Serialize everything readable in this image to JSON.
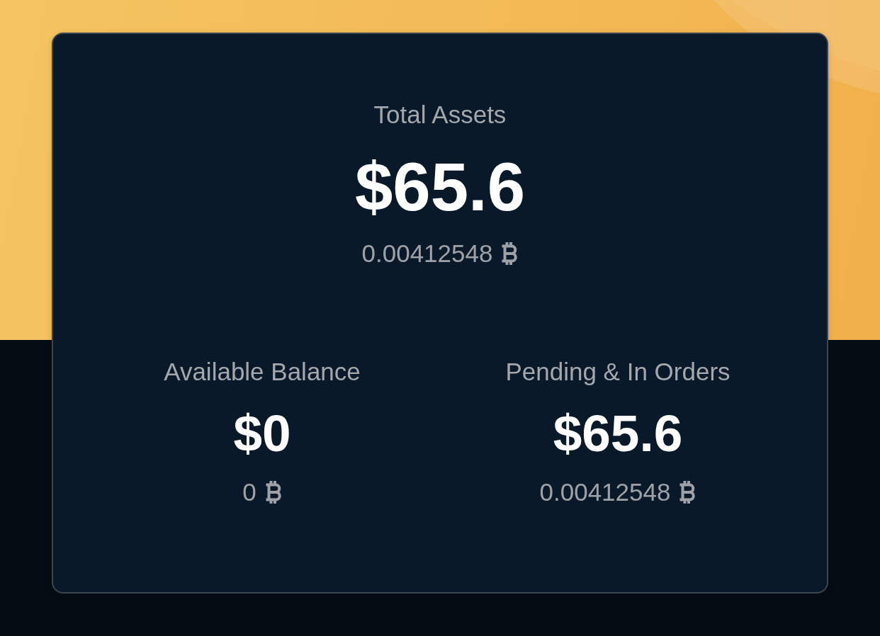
{
  "summary": {
    "label": "Total Assets",
    "usd_value": "$65.6",
    "btc_value": "0.00412548"
  },
  "breakdown": [
    {
      "label": "Available Balance",
      "usd_value": "$0",
      "btc_value": "0"
    },
    {
      "label": "Pending & In Orders",
      "usd_value": "$65.6",
      "btc_value": "0.00412548"
    }
  ]
}
